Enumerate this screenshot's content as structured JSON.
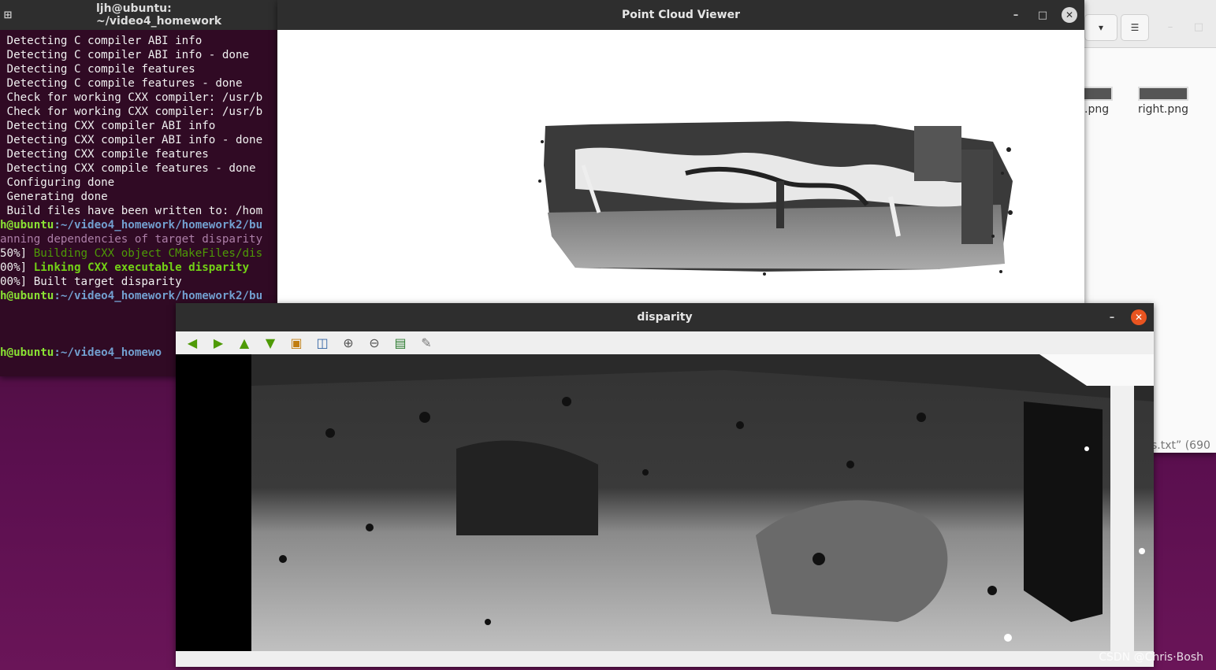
{
  "terminal": {
    "title": "ljh@ubuntu: ~/video4_homework",
    "lines": [
      {
        "cls": "",
        "text": " Detecting C compiler ABI info"
      },
      {
        "cls": "",
        "text": " Detecting C compiler ABI info - done"
      },
      {
        "cls": "",
        "text": " Detecting C compile features"
      },
      {
        "cls": "",
        "text": " Detecting C compile features - done"
      },
      {
        "cls": "",
        "text": " Check for working CXX compiler: /usr/b"
      },
      {
        "cls": "",
        "text": " Check for working CXX compiler: /usr/b"
      },
      {
        "cls": "",
        "text": " Detecting CXX compiler ABI info"
      },
      {
        "cls": "",
        "text": " Detecting CXX compiler ABI info - done"
      },
      {
        "cls": "",
        "text": " Detecting CXX compile features"
      },
      {
        "cls": "",
        "text": " Detecting CXX compile features - done"
      },
      {
        "cls": "",
        "text": " Configuring done"
      },
      {
        "cls": "",
        "text": " Generating done"
      },
      {
        "cls": "",
        "text": " Build files have been written to: /hom"
      },
      {
        "cls": "prompt",
        "user": "h@ubuntu",
        "path": ":~/video4_homework/homework2/bu"
      },
      {
        "cls": "purple",
        "text": "anning dependencies of target disparity"
      },
      {
        "cls": "build",
        "pre": "50%] ",
        "text": "Building CXX object CMakeFiles/dis"
      },
      {
        "cls": "link",
        "pre": "00%] ",
        "text": "Linking CXX executable disparity"
      },
      {
        "cls": "",
        "text": "00%] Built target disparity"
      },
      {
        "cls": "prompt",
        "user": "h@ubuntu",
        "path": ":~/video4_homework/homework2/bu"
      },
      {
        "cls": "",
        "text": ""
      },
      {
        "cls": "",
        "text": ""
      },
      {
        "cls": "",
        "text": ""
      },
      {
        "cls": "prompt",
        "user": "h@ubuntu",
        "path": ":~/video4_homewo"
      }
    ]
  },
  "point_cloud": {
    "title": "Point Cloud Viewer"
  },
  "disparity": {
    "title": "disparity",
    "minimize": "–",
    "close": "✕"
  },
  "files": {
    "file1": ".png",
    "file2": "right.png",
    "status": "s.txt” (690"
  },
  "watermark": "CSDN @Chris·Bosh",
  "colors": {
    "accent_close": "#e95420",
    "terminal_bg": "#300a24",
    "titlebar": "#2e2e2e"
  }
}
